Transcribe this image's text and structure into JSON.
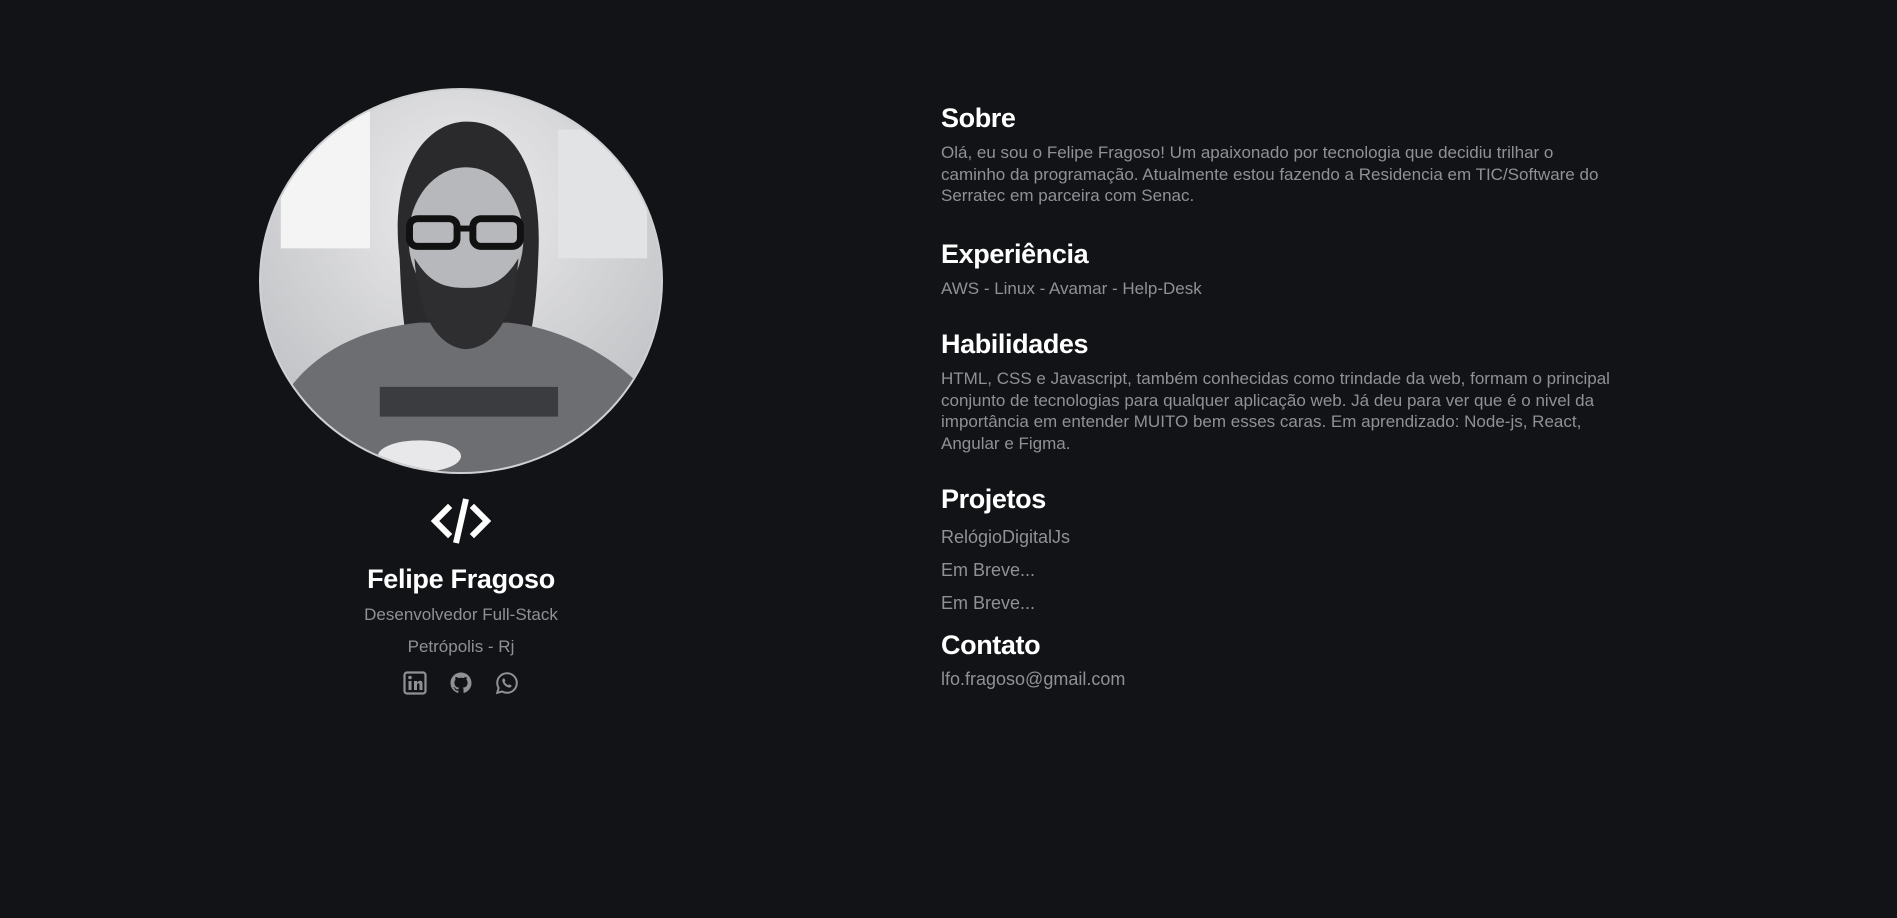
{
  "profile": {
    "name": "Felipe Fragoso",
    "role": "Desenvolvedor Full-Stack",
    "location": "Petrópolis - Rj",
    "socials": [
      {
        "icon": "linkedin-icon"
      },
      {
        "icon": "github-icon"
      },
      {
        "icon": "whatsapp-icon"
      }
    ]
  },
  "sections": {
    "about": {
      "title": "Sobre",
      "text": "Olá, eu sou o Felipe Fragoso! Um apaixonado por tecnologia que decidiu trilhar o caminho da programação. Atualmente estou fazendo a Residencia em TIC/Software do Serratec em parceira com Senac."
    },
    "experience": {
      "title": "Experiência",
      "text": "AWS - Linux - Avamar - Help-Desk"
    },
    "skills": {
      "title": "Habilidades",
      "text": "HTML, CSS e Javascript, também conhecidas como trindade da web, formam o principal conjunto de tecnologias para qualquer aplicação web. Já deu para ver que é o nivel da importância em entender MUITO bem esses caras. Em aprendizado: Node-js, React, Angular e Figma."
    },
    "projects": {
      "title": "Projetos",
      "items": [
        "RelógioDigitalJs",
        "Em Breve...",
        "Em Breve..."
      ]
    },
    "contact": {
      "title": "Contato",
      "email": "lfo.fragoso@gmail.com"
    }
  },
  "colors": {
    "background": "#121316",
    "heading": "#ffffff",
    "muted_text": "#8f9197"
  }
}
